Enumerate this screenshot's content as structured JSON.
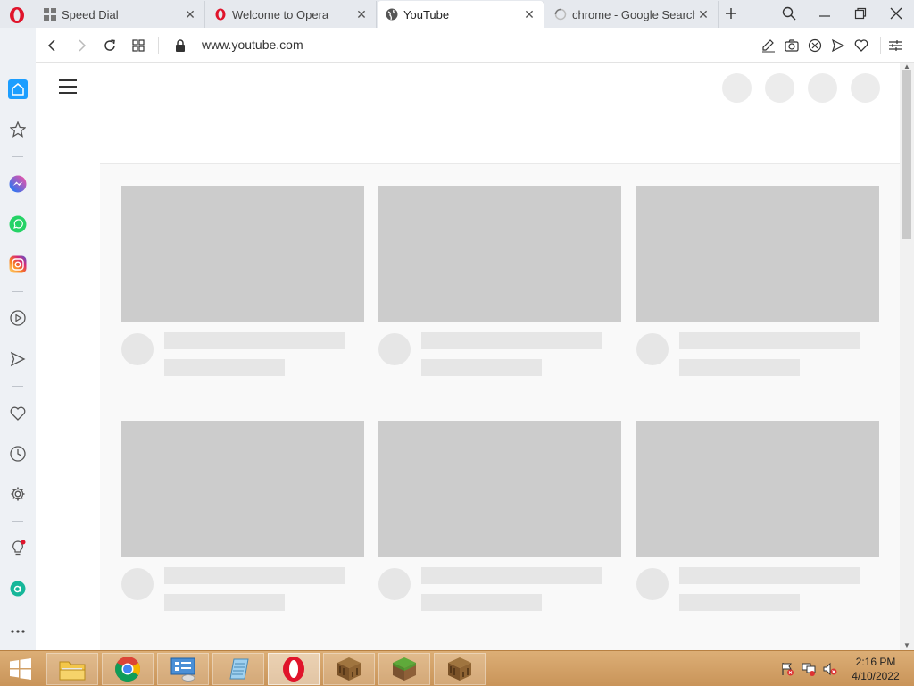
{
  "browser": {
    "tabs": [
      {
        "title": "Speed Dial",
        "icon": "speed-dial-icon",
        "active": false
      },
      {
        "title": "Welcome to Opera",
        "icon": "opera-icon",
        "active": false
      },
      {
        "title": "YouTube",
        "icon": "globe-icon",
        "active": true
      },
      {
        "title": "chrome - Google Search",
        "icon": "loading-icon",
        "active": false
      }
    ],
    "address": "www.youtube.com"
  },
  "page": {
    "state": "loading-skeleton",
    "video_placeholder_count": 6
  },
  "taskbar": {
    "apps": [
      "file-explorer",
      "chrome",
      "control-panel",
      "notepad",
      "opera",
      "minecraft-crafting-table",
      "minecraft-grass-block",
      "minecraft-crafting-table"
    ],
    "clock": {
      "time": "2:16 PM",
      "date": "4/10/2022"
    }
  },
  "colors": {
    "accent": "#1c9eff",
    "opera_red": "#e0142b",
    "placeholder": "#cccccc",
    "taskbar": "#d6a46b"
  }
}
